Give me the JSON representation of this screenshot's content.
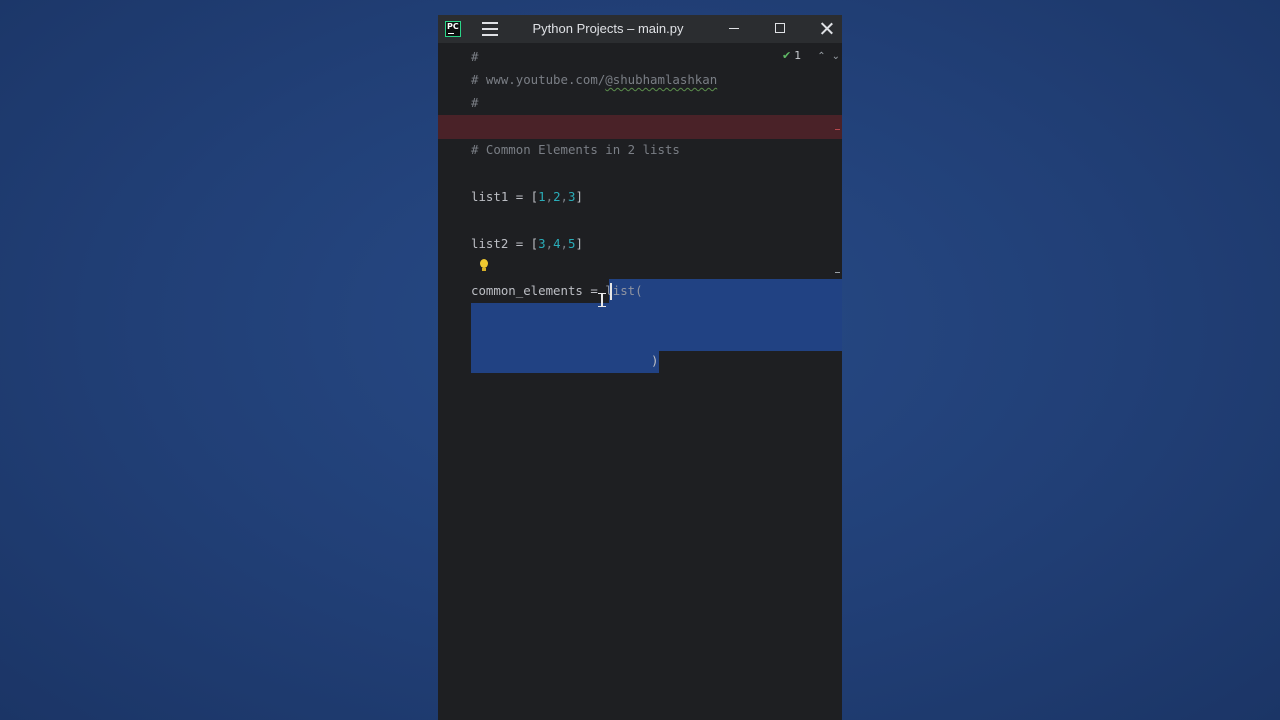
{
  "window": {
    "title": "Python Projects – main.py",
    "logo_text": "PC"
  },
  "inspection": {
    "count": "1"
  },
  "code": {
    "line1": "#",
    "line2_prefix": "# www.youtube.com/",
    "line2_handle": "@shubhamlashkan",
    "line3": "#",
    "comment": "# Common Elements in 2 lists",
    "list1_name": "list1 = [",
    "list1_a": "1",
    "list1_b": "2",
    "list1_c": "3",
    "list2_name": "list2 = [",
    "list2_a": "3",
    "list2_b": "4",
    "list2_c": "5",
    "common_lhs": "common_elements = ",
    "common_rhs": "list(",
    "close_paren": ")"
  },
  "colors": {
    "selection": "#214283",
    "error_line": "#4a2228",
    "number": "#2aacb8",
    "comment": "#7a7e85"
  }
}
